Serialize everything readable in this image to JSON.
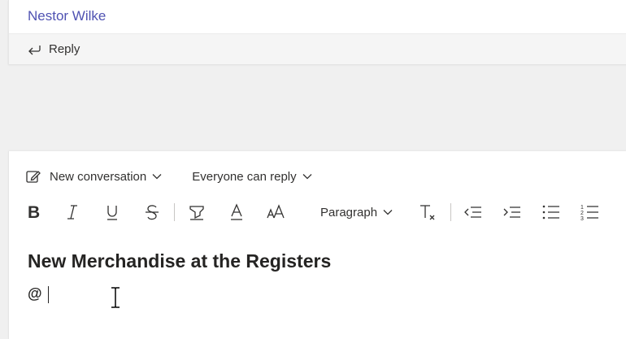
{
  "previous_message": {
    "sender": "Nestor Wilke",
    "reply_label": "Reply"
  },
  "composer": {
    "post_type_label": "New conversation",
    "permission_label": "Everyone can reply",
    "paragraph_label": "Paragraph",
    "subject": "New Merchandise at the Registers",
    "body": "@"
  },
  "toolbar": [
    "bold",
    "italic",
    "underline",
    "strikethrough",
    "highlight",
    "font-color",
    "font-size",
    "paragraph",
    "clear-formatting",
    "decrease-indent",
    "increase-indent",
    "bulleted-list",
    "numbered-list"
  ],
  "colors": {
    "sender": "#4f52b2",
    "background": "#f0f0f0",
    "card": "#ffffff",
    "text": "#252423"
  }
}
